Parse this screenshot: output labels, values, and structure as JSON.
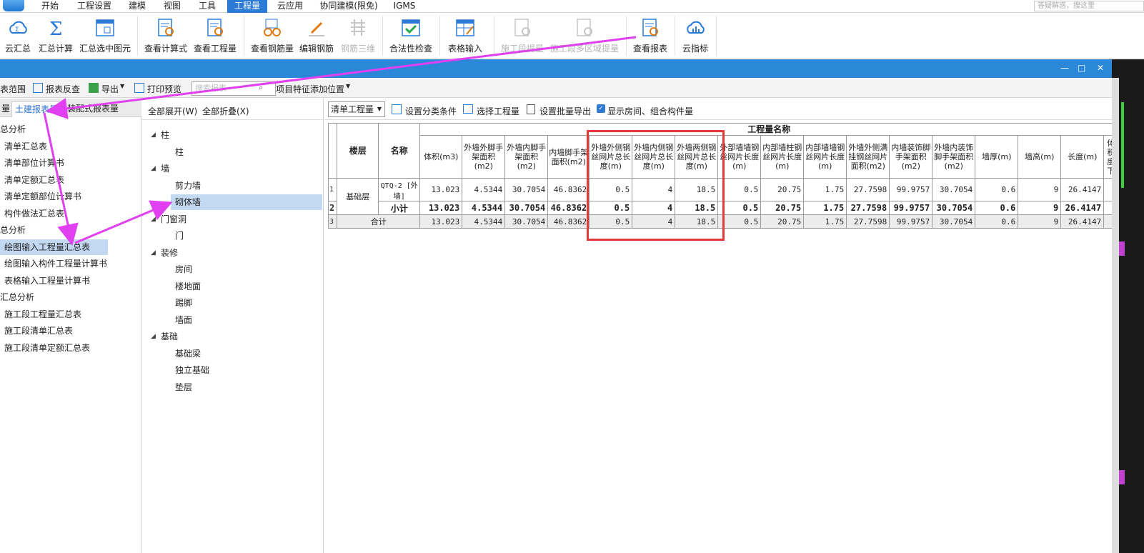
{
  "menu": {
    "tabs": [
      "开始",
      "工程设置",
      "建模",
      "视图",
      "工具",
      "工程量",
      "云应用",
      "协同建模(限免)",
      "IGMS"
    ],
    "active": "工程量",
    "search_placeholder": "答疑解惑，搜这里"
  },
  "ribbon": {
    "buttons": [
      {
        "label": "云汇总",
        "icon": "cloud-sum-icon",
        "disabled": false
      },
      {
        "label": "汇总计算",
        "icon": "sigma-icon",
        "disabled": false
      },
      {
        "label": "汇总选中图元",
        "icon": "select-sum-icon",
        "disabled": false
      },
      {
        "label": "查看计算式",
        "icon": "view-formula-icon",
        "disabled": false
      },
      {
        "label": "查看工程量",
        "icon": "view-quantity-icon",
        "disabled": false
      },
      {
        "label": "查看钢筋量",
        "icon": "glasses-icon",
        "disabled": false
      },
      {
        "label": "编辑钢筋",
        "icon": "pen-icon",
        "disabled": false
      },
      {
        "label": "钢筋三维",
        "icon": "rebar-3d-icon",
        "disabled": true
      },
      {
        "label": "合法性检查",
        "icon": "check-icon",
        "disabled": false
      },
      {
        "label": "表格输入",
        "icon": "table-input-icon",
        "disabled": false
      },
      {
        "label": "施工段提量",
        "icon": "stage-quantity-icon",
        "disabled": true
      },
      {
        "label": "施工段多区域提量",
        "icon": "multi-region-icon",
        "disabled": true
      },
      {
        "label": "查看报表",
        "icon": "report-icon",
        "disabled": false
      },
      {
        "label": "云指标",
        "icon": "cloud-index-icon",
        "disabled": false
      }
    ]
  },
  "window": {
    "minimize": "—",
    "maximize": "□",
    "close": "✕"
  },
  "toolbar2": {
    "range": "表范围",
    "report_check": "报表反查",
    "export": "导出",
    "print_preview": "打印预览",
    "search_placeholder": "搜索报表",
    "feature_position": "项目特征添加位置"
  },
  "left": {
    "tabs": [
      "量",
      "土建报表量",
      "装配式报表量"
    ],
    "active_tab": "土建报表量",
    "items": [
      {
        "label": "总分析",
        "level": 0
      },
      {
        "label": "清单汇总表",
        "level": 1
      },
      {
        "label": "清单部位计算书",
        "level": 1
      },
      {
        "label": "清单定额汇总表",
        "level": 1
      },
      {
        "label": "清单定额部位计算书",
        "level": 1
      },
      {
        "label": "构件做法汇总表",
        "level": 1
      },
      {
        "label": "总分析",
        "level": 0
      },
      {
        "label": "绘图输入工程量汇总表",
        "level": 1,
        "selected": true
      },
      {
        "label": "绘图输入构件工程量计算书",
        "level": 1
      },
      {
        "label": "表格输入工程量计算书",
        "level": 1
      },
      {
        "label": "汇总分析",
        "level": 0
      },
      {
        "label": "施工段工程量汇总表",
        "level": 1
      },
      {
        "label": "施工段清单汇总表",
        "level": 1
      },
      {
        "label": "施工段清单定额汇总表",
        "level": 1
      }
    ]
  },
  "middle": {
    "expand_all": "全部展开(W)",
    "collapse_all": "全部折叠(X)",
    "tree": [
      {
        "label": "柱",
        "level": 0
      },
      {
        "label": "柱",
        "level": 1
      },
      {
        "label": "墙",
        "level": 0
      },
      {
        "label": "剪力墙",
        "level": 1
      },
      {
        "label": "砌体墙",
        "level": 1,
        "selected": true
      },
      {
        "label": "门窗洞",
        "level": 0
      },
      {
        "label": "门",
        "level": 1
      },
      {
        "label": "装修",
        "level": 0
      },
      {
        "label": "房间",
        "level": 1
      },
      {
        "label": "楼地面",
        "level": 1
      },
      {
        "label": "踢脚",
        "level": 1
      },
      {
        "label": "墙面",
        "level": 1
      },
      {
        "label": "基础",
        "level": 0
      },
      {
        "label": "基础梁",
        "level": 1
      },
      {
        "label": "独立基础",
        "level": 1
      },
      {
        "label": "垫层",
        "level": 1
      }
    ]
  },
  "right": {
    "dropdown": "清单工程量",
    "set_category": "设置分类条件",
    "select_quantity": "选择工程量",
    "batch_export": "设置批量导出",
    "show_rooms": "显示房间、组合构件量",
    "show_rooms_checked": true
  },
  "table": {
    "group_header": "工程量名称",
    "col_floor": "楼层",
    "col_name": "名称",
    "columns": [
      "体积(m3)",
      "外墙外脚手架面积(m2)",
      "外墙内脚手架面积(m2)",
      "内墙脚手架面积(m2)",
      "外墙外侧钢丝网片总长度(m)",
      "外墙内侧钢丝网片总长度(m)",
      "外墙两侧钢丝网片总长度(m)",
      "外部墙墙钢丝网片长度(m)",
      "内部墙柱钢丝网片长度(m)",
      "内部墙墙钢丝网片长度(m)",
      "外墙外侧满挂钢丝网片面积(m2)",
      "内墙装饰脚手架面积(m2)",
      "外墙内装饰脚手架面积(m2)",
      "墙厚(m)",
      "墙高(m)",
      "长度(m)",
      "体积度下"
    ],
    "rows": [
      {
        "n": "1",
        "floor": "基础层",
        "name": "QTQ-2 [外墙]",
        "values": [
          "13.023",
          "4.5344",
          "30.7054",
          "46.8362",
          "0.5",
          "4",
          "18.5",
          "0.5",
          "20.75",
          "1.75",
          "27.7598",
          "99.9757",
          "30.7054",
          "0.6",
          "9",
          "26.4147",
          ""
        ]
      },
      {
        "n": "2",
        "floor": "",
        "name": "小计",
        "values": [
          "13.023",
          "4.5344",
          "30.7054",
          "46.8362",
          "0.5",
          "4",
          "18.5",
          "0.5",
          "20.75",
          "1.75",
          "27.7598",
          "99.9757",
          "30.7054",
          "0.6",
          "9",
          "26.4147",
          ""
        ]
      },
      {
        "n": "3",
        "floor": "合计",
        "name": "",
        "values": [
          "13.023",
          "4.5344",
          "30.7054",
          "46.8362",
          "0.5",
          "4",
          "18.5",
          "0.5",
          "20.75",
          "1.75",
          "27.7598",
          "99.9757",
          "30.7054",
          "0.6",
          "9",
          "26.4147",
          ""
        ]
      }
    ]
  },
  "colors": {
    "accent": "#2b88d8",
    "highlight": "#c3d8f1",
    "annotation_arrow": "#e040f0",
    "annotation_box": "#e53a3a"
  }
}
